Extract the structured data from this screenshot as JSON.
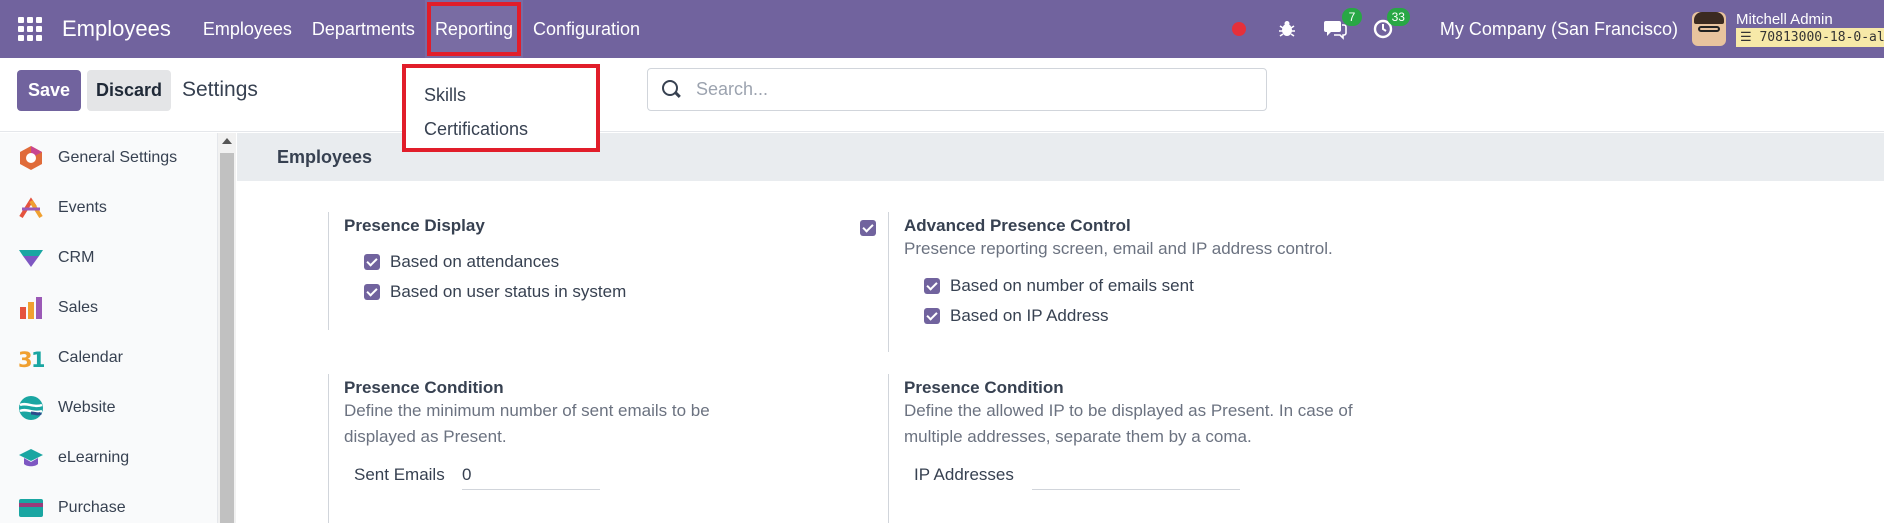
{
  "navbar": {
    "app_name": "Employees",
    "menu": [
      "Employees",
      "Departments",
      "Reporting",
      "Configuration"
    ],
    "messages_count": "7",
    "activities_count": "33",
    "company": "My Company (San Francisco)",
    "user_name": "Mitchell Admin",
    "database": "70813000-18-0-al"
  },
  "control": {
    "save_label": "Save",
    "discard_label": "Discard",
    "breadcrumb": "Settings",
    "search_placeholder": "Search..."
  },
  "reporting_menu": {
    "items": [
      "Skills",
      "Certifications"
    ]
  },
  "sidebar": {
    "items": [
      {
        "label": "General Settings",
        "icon": "general-settings-icon"
      },
      {
        "label": "Events",
        "icon": "events-icon"
      },
      {
        "label": "CRM",
        "icon": "crm-icon"
      },
      {
        "label": "Sales",
        "icon": "sales-icon"
      },
      {
        "label": "Calendar",
        "icon": "calendar-icon"
      },
      {
        "label": "Website",
        "icon": "website-icon"
      },
      {
        "label": "eLearning",
        "icon": "elearning-icon"
      },
      {
        "label": "Purchase",
        "icon": "purchase-icon"
      }
    ]
  },
  "main": {
    "section_title": "Employees",
    "presence_display": {
      "title": "Presence Display",
      "options": [
        "Based on attendances",
        "Based on user status in system"
      ]
    },
    "advanced_presence": {
      "title": "Advanced Presence Control",
      "description": "Presence reporting screen, email and IP address control.",
      "options": [
        "Based on number of emails sent",
        "Based on IP Address"
      ]
    },
    "presence_condition_emails": {
      "title": "Presence Condition",
      "description": "Define the minimum number of sent emails to be displayed as Present.",
      "field_label": "Sent Emails",
      "field_value": "0"
    },
    "presence_condition_ip": {
      "title": "Presence Condition",
      "description": "Define the allowed IP to be displayed as Present. In case of multiple addresses, separate them by a coma.",
      "field_label": "IP Addresses",
      "field_value": ""
    }
  },
  "colors": {
    "navbar": "#71639e",
    "highlight": "#e11d2a",
    "primary": "#71639e"
  }
}
